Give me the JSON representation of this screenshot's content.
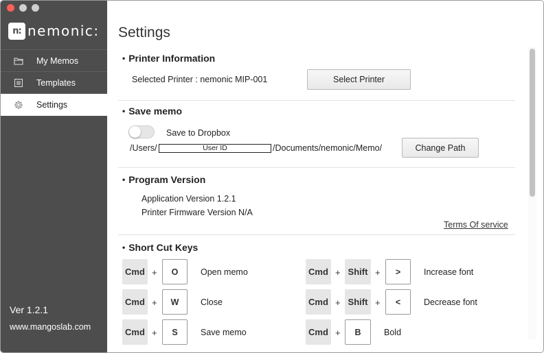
{
  "window": {
    "controls": [
      "close",
      "minimize",
      "zoom"
    ]
  },
  "sidebar": {
    "logo_mark": "n:",
    "logo_text": "nemonic:",
    "items": [
      {
        "label": "My Memos",
        "icon": "folder-icon",
        "active": false
      },
      {
        "label": "Templates",
        "icon": "template-icon",
        "active": false
      },
      {
        "label": "Settings",
        "icon": "gear-icon",
        "active": true
      }
    ],
    "version": "Ver 1.2.1",
    "website": "www.mangoslab.com"
  },
  "main": {
    "title": "Settings",
    "printer": {
      "section_title": "Printer Information",
      "selected_printer": "Selected Printer : nemonic MIP-001",
      "select_button": "Select Printer"
    },
    "save_memo": {
      "section_title": "Save memo",
      "dropbox_label": "Save to Dropbox",
      "dropbox_enabled": false,
      "path_prefix": "/Users/",
      "user_id_placeholder": "User ID",
      "path_suffix": "/Documents/nemonic/Memo/",
      "change_path_button": "Change Path"
    },
    "program_version": {
      "section_title": "Program Version",
      "app_version": "Application Version 1.2.1",
      "firmware_version": "Printer Firmware Version N/A",
      "terms_link": "Terms Of service"
    },
    "shortcuts": {
      "section_title": "Short Cut Keys",
      "plus": "+",
      "left": [
        {
          "modifiers": [
            "Cmd"
          ],
          "key": "O",
          "action": "Open memo"
        },
        {
          "modifiers": [
            "Cmd"
          ],
          "key": "W",
          "action": "Close"
        },
        {
          "modifiers": [
            "Cmd"
          ],
          "key": "S",
          "action": "Save memo"
        }
      ],
      "right": [
        {
          "modifiers": [
            "Cmd",
            "Shift"
          ],
          "key": ">",
          "action": "Increase font"
        },
        {
          "modifiers": [
            "Cmd",
            "Shift"
          ],
          "key": "<",
          "action": "Decrease font"
        },
        {
          "modifiers": [
            "Cmd"
          ],
          "key": "B",
          "action": "Bold"
        }
      ]
    }
  },
  "colors": {
    "sidebar_bg": "#4d4d4d",
    "close_button": "#fc5f57",
    "inactive_control": "#cfcfcf",
    "key_bg": "#e6e6e6"
  }
}
